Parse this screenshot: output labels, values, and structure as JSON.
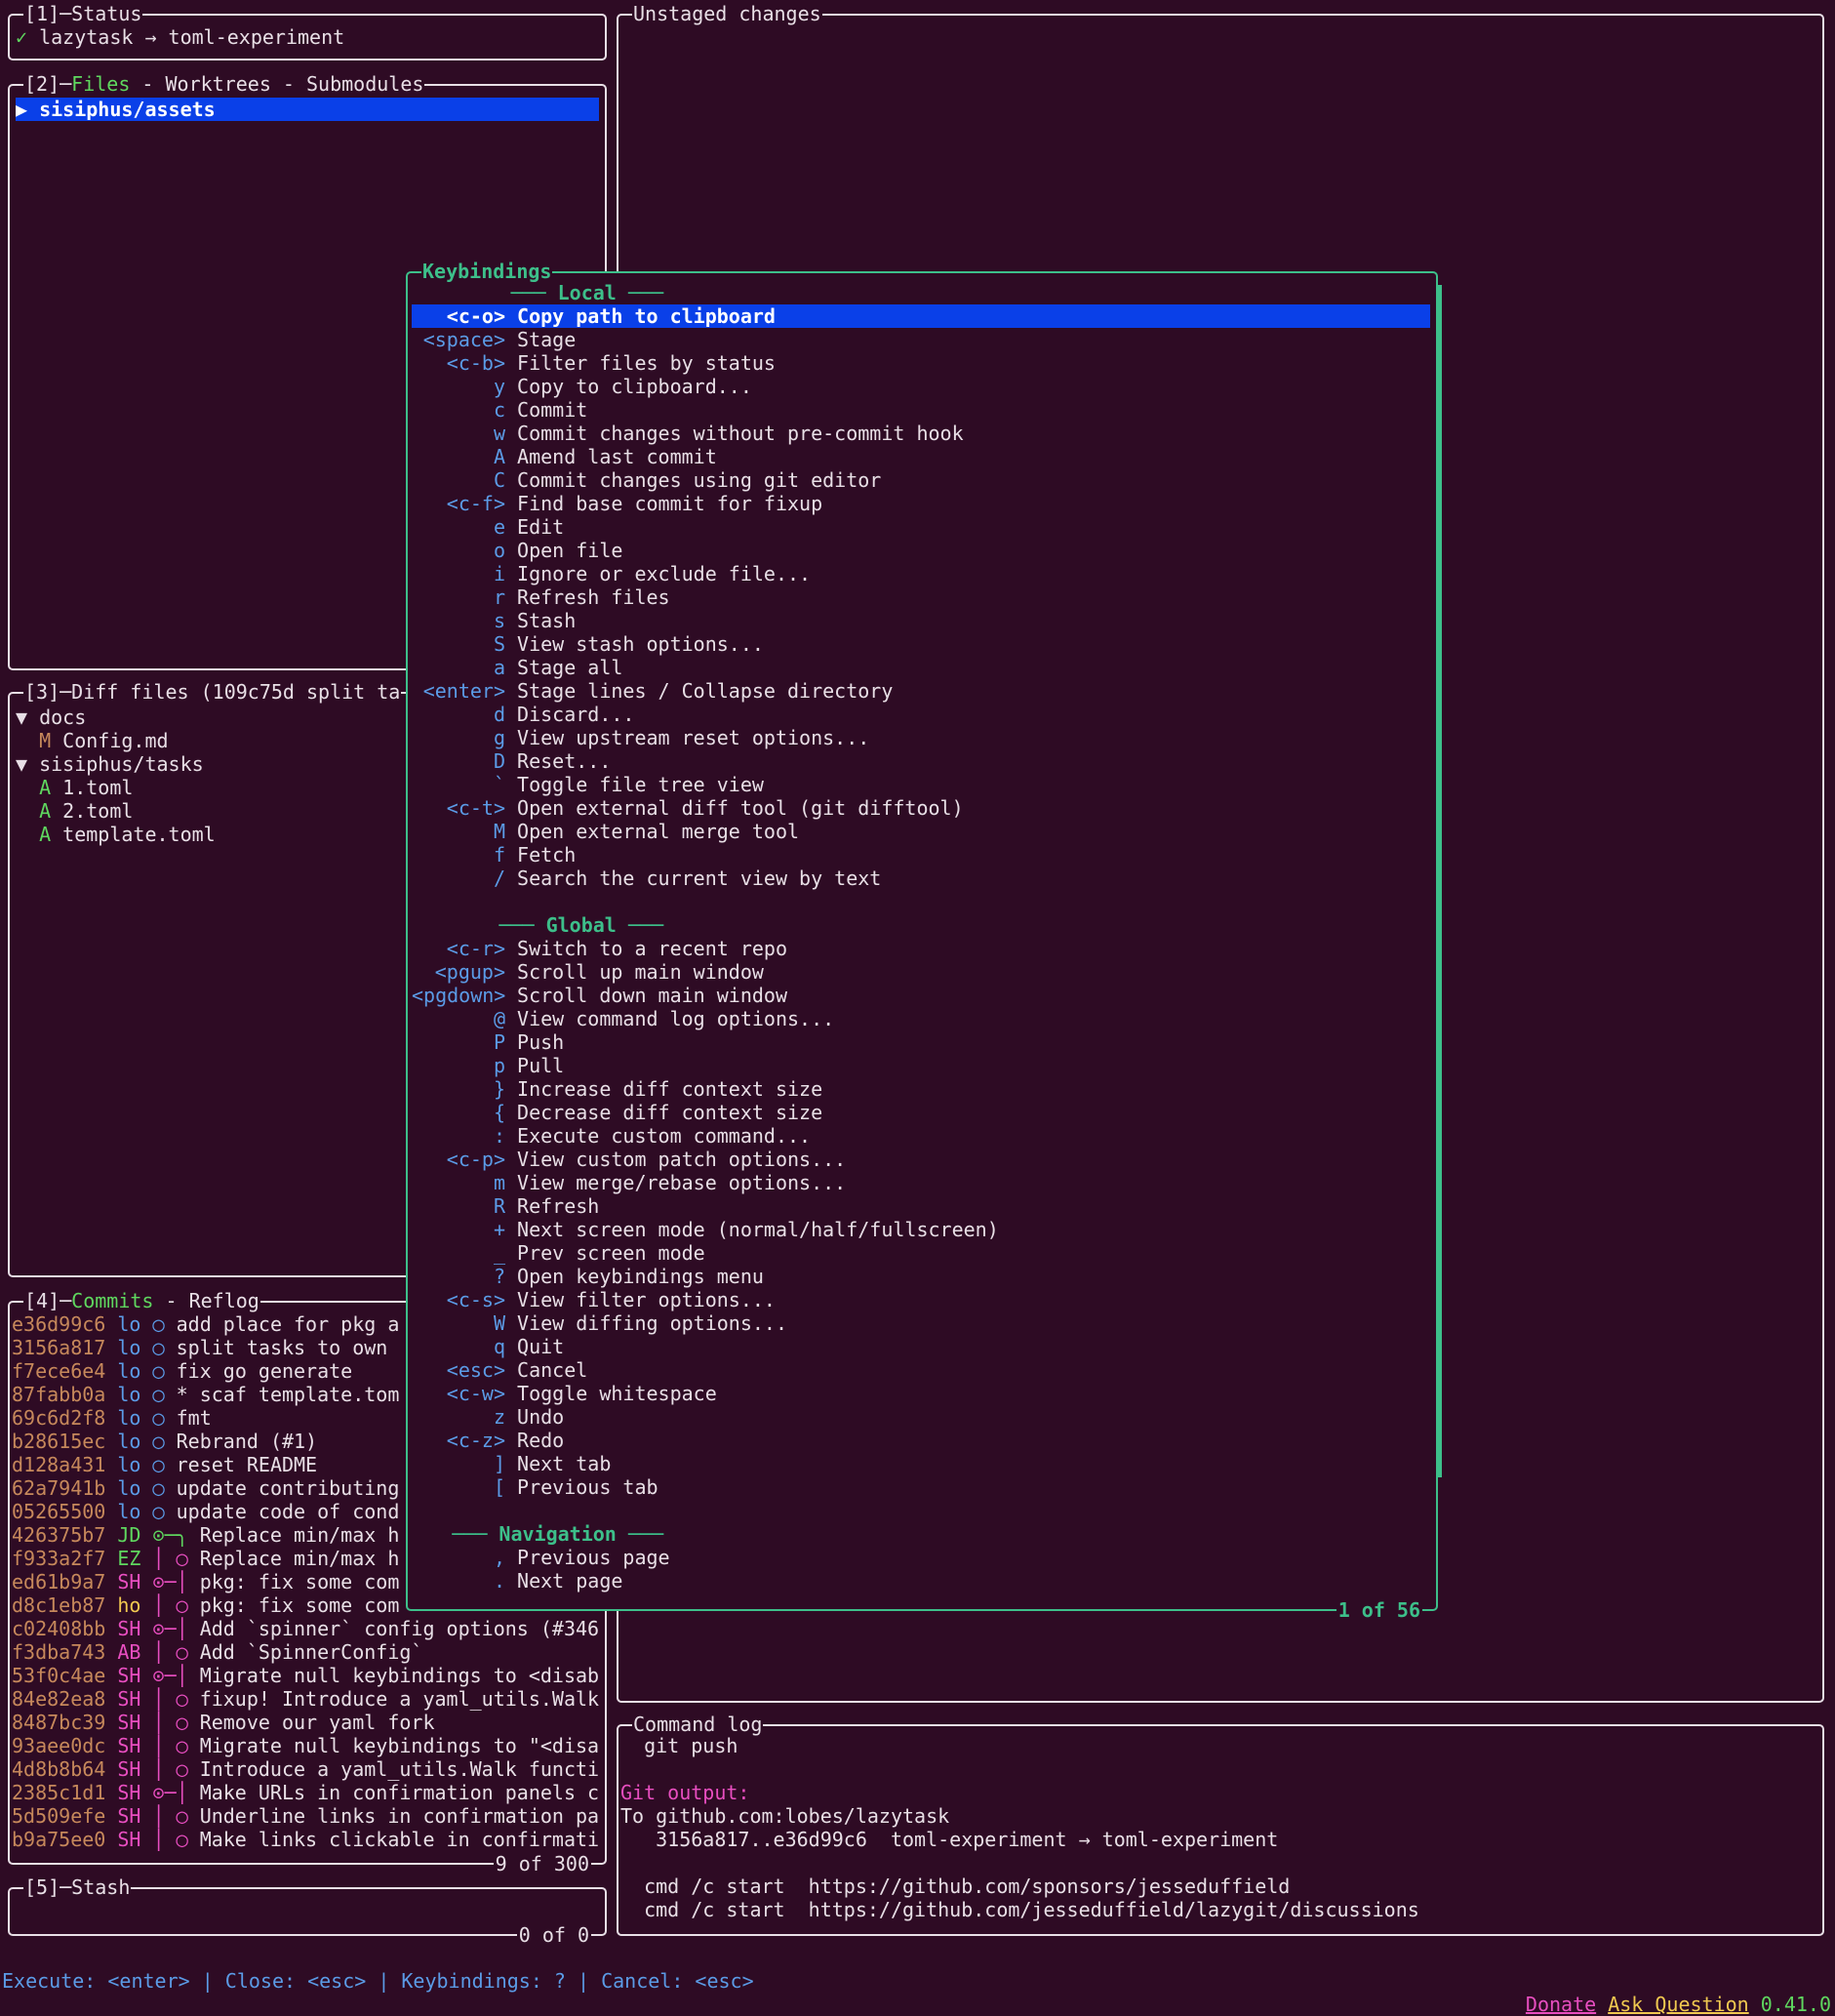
{
  "status_panel": {
    "title": "[1]─Status",
    "check": "✓",
    "text": "lazytask → toml-experiment"
  },
  "files_panel": {
    "title_prefix": "[2]─",
    "title_active": "Files",
    "title_rest": " - Worktrees - Submodules",
    "selected_item": "▶ sisiphus/assets"
  },
  "diff_panel": {
    "title": "[3]─Diff files (109c75d split ta",
    "items": [
      {
        "status": "",
        "text": "▼ docs"
      },
      {
        "status": "M",
        "text": " Config.md"
      },
      {
        "status": "",
        "text": "▼ sisiphus/tasks"
      },
      {
        "status": "A",
        "text": " 1.toml"
      },
      {
        "status": "A",
        "text": " 2.toml"
      },
      {
        "status": "A",
        "text": " template.toml"
      }
    ]
  },
  "commits_panel": {
    "title_prefix": "[4]─",
    "title_active": "Commits",
    "title_rest": " - Reflog",
    "footer": "9 of 300",
    "rows": [
      {
        "hash": "e36d99c6",
        "author": "lo",
        "graph": "◯",
        "msg": "add place for pkg a"
      },
      {
        "hash": "3156a817",
        "author": "lo",
        "graph": "◯",
        "msg": "split tasks to own"
      },
      {
        "hash": "f7ece6e4",
        "author": "lo",
        "graph": "◯",
        "msg": "fix go generate"
      },
      {
        "hash": "87fabb0a",
        "author": "lo",
        "graph": "◯",
        "msg": "* scaf template.tom"
      },
      {
        "hash": "69c6d2f8",
        "author": "lo",
        "graph": "◯",
        "msg": "fmt"
      },
      {
        "hash": "b28615ec",
        "author": "lo",
        "graph": "◯",
        "msg": "Rebrand (#1)"
      },
      {
        "hash": "d128a431",
        "author": "lo",
        "graph": "◯",
        "msg": "reset README"
      },
      {
        "hash": "62a7941b",
        "author": "lo",
        "graph": "◯",
        "msg": "update contributing"
      },
      {
        "hash": "05265500",
        "author": "lo",
        "graph": "◯",
        "msg": "update code of cond"
      },
      {
        "hash": "426375b7",
        "author": "JD",
        "graph": "⊙─╮",
        "msg": "Replace min/max h"
      },
      {
        "hash": "f933a2f7",
        "author": "EZ",
        "graph": "│ ◯",
        "msg": "Replace min/max h"
      },
      {
        "hash": "ed61b9a7",
        "author": "SH",
        "graph": "⊙─│",
        "msg": "pkg: fix some com"
      },
      {
        "hash": "d8c1eb87",
        "author": "ho",
        "graph": "│ ◯",
        "msg": "pkg: fix some com"
      },
      {
        "hash": "c02408bb",
        "author": "SH",
        "graph": "⊙─│",
        "msg": "Add `spinner` config options (#346"
      },
      {
        "hash": "f3dba743",
        "author": "AB",
        "graph": "│ ◯",
        "msg": "Add `SpinnerConfig`"
      },
      {
        "hash": "53f0c4ae",
        "author": "SH",
        "graph": "⊙─│",
        "msg": "Migrate null keybindings to <disab"
      },
      {
        "hash": "84e82ea8",
        "author": "SH",
        "graph": "│ ◯",
        "msg": "fixup! Introduce a yaml_utils.Walk"
      },
      {
        "hash": "8487bc39",
        "author": "SH",
        "graph": "│ ◯",
        "msg": "Remove our yaml fork"
      },
      {
        "hash": "93aee0dc",
        "author": "SH",
        "graph": "│ ◯",
        "msg": "Migrate null keybindings to \"<disa"
      },
      {
        "hash": "4d8b8b64",
        "author": "SH",
        "graph": "│ ◯",
        "msg": "Introduce a yaml_utils.Walk functi"
      },
      {
        "hash": "2385c1d1",
        "author": "SH",
        "graph": "⊙─│",
        "msg": "Make URLs in confirmation panels c"
      },
      {
        "hash": "5d509efe",
        "author": "SH",
        "graph": "│ ◯",
        "msg": "Underline links in confirmation pa"
      },
      {
        "hash": "b9a75ee0",
        "author": "SH",
        "graph": "│ ◯",
        "msg": "Make links clickable in confirmati"
      }
    ]
  },
  "stash_panel": {
    "title": "[5]─Stash",
    "footer": "0 of 0"
  },
  "unstaged_panel": {
    "title": "Unstaged changes"
  },
  "command_log": {
    "title": "Command log",
    "lines": [
      {
        "cls": "",
        "text": "  git push"
      },
      {
        "cls": "",
        "text": ""
      },
      {
        "cls": "gitout",
        "text": "Git output:"
      },
      {
        "cls": "",
        "text": "To github.com:lobes/lazytask"
      },
      {
        "cls": "",
        "text": "   3156a817..e36d99c6  toml-experiment → toml-experiment"
      },
      {
        "cls": "",
        "text": ""
      },
      {
        "cls": "",
        "text": "  cmd /c start  https://github.com/sponsors/jesseduffield"
      },
      {
        "cls": "",
        "text": "  cmd /c start  https://github.com/jesseduffield/lazygit/discussions"
      }
    ]
  },
  "keybindings": {
    "title": "Keybindings",
    "footer": "1 of 56",
    "sections": [
      {
        "header": "─── Local ───",
        "rows": [
          {
            "key": "<c-o>",
            "label": "Copy path to clipboard",
            "selected": true
          },
          {
            "key": "<space>",
            "label": "Stage"
          },
          {
            "key": "<c-b>",
            "label": "Filter files by status"
          },
          {
            "key": "y",
            "label": "Copy to clipboard..."
          },
          {
            "key": "c",
            "label": "Commit"
          },
          {
            "key": "w",
            "label": "Commit changes without pre-commit hook"
          },
          {
            "key": "A",
            "label": "Amend last commit"
          },
          {
            "key": "C",
            "label": "Commit changes using git editor"
          },
          {
            "key": "<c-f>",
            "label": "Find base commit for fixup"
          },
          {
            "key": "e",
            "label": "Edit"
          },
          {
            "key": "o",
            "label": "Open file"
          },
          {
            "key": "i",
            "label": "Ignore or exclude file..."
          },
          {
            "key": "r",
            "label": "Refresh files"
          },
          {
            "key": "s",
            "label": "Stash"
          },
          {
            "key": "S",
            "label": "View stash options..."
          },
          {
            "key": "a",
            "label": "Stage all"
          },
          {
            "key": "<enter>",
            "label": "Stage lines / Collapse directory"
          },
          {
            "key": "d",
            "label": "Discard..."
          },
          {
            "key": "g",
            "label": "View upstream reset options..."
          },
          {
            "key": "D",
            "label": "Reset..."
          },
          {
            "key": "`",
            "label": "Toggle file tree view"
          },
          {
            "key": "<c-t>",
            "label": "Open external diff tool (git difftool)"
          },
          {
            "key": "M",
            "label": "Open external merge tool"
          },
          {
            "key": "f",
            "label": "Fetch"
          },
          {
            "key": "/",
            "label": "Search the current view by text"
          }
        ]
      },
      {
        "header": "─── Global ───",
        "rows": [
          {
            "key": "<c-r>",
            "label": "Switch to a recent repo"
          },
          {
            "key": "<pgup>",
            "label": "Scroll up main window"
          },
          {
            "key": "<pgdown>",
            "label": "Scroll down main window"
          },
          {
            "key": "@",
            "label": "View command log options..."
          },
          {
            "key": "P",
            "label": "Push"
          },
          {
            "key": "p",
            "label": "Pull"
          },
          {
            "key": "}",
            "label": "Increase diff context size"
          },
          {
            "key": "{",
            "label": "Decrease diff context size"
          },
          {
            "key": ":",
            "label": "Execute custom command..."
          },
          {
            "key": "<c-p>",
            "label": "View custom patch options..."
          },
          {
            "key": "m",
            "label": "View merge/rebase options..."
          },
          {
            "key": "R",
            "label": "Refresh"
          },
          {
            "key": "+",
            "label": "Next screen mode (normal/half/fullscreen)"
          },
          {
            "key": "_",
            "label": "Prev screen mode"
          },
          {
            "key": "?",
            "label": "Open keybindings menu"
          },
          {
            "key": "<c-s>",
            "label": "View filter options..."
          },
          {
            "key": "W",
            "label": "View diffing options..."
          },
          {
            "key": "q",
            "label": "Quit"
          },
          {
            "key": "<esc>",
            "label": "Cancel"
          },
          {
            "key": "<c-w>",
            "label": "Toggle whitespace"
          },
          {
            "key": "z",
            "label": "Undo"
          },
          {
            "key": "<c-z>",
            "label": "Redo"
          },
          {
            "key": "]",
            "label": "Next tab"
          },
          {
            "key": "[",
            "label": "Previous tab"
          }
        ]
      },
      {
        "header": "─── Navigation ───",
        "rows": [
          {
            "key": ",",
            "label": "Previous page"
          },
          {
            "key": ".",
            "label": "Next page"
          }
        ]
      }
    ]
  },
  "bottom_bar": {
    "hint": "Execute: <enter> | Close: <esc> | Keybindings: ? | Cancel: <esc>",
    "donate": "Donate",
    "ask": "Ask Question",
    "version": "0.41.0"
  },
  "colors": {
    "background": "#2e0b24",
    "accent": "#3dbf8a",
    "selection": "#0a40e8"
  }
}
